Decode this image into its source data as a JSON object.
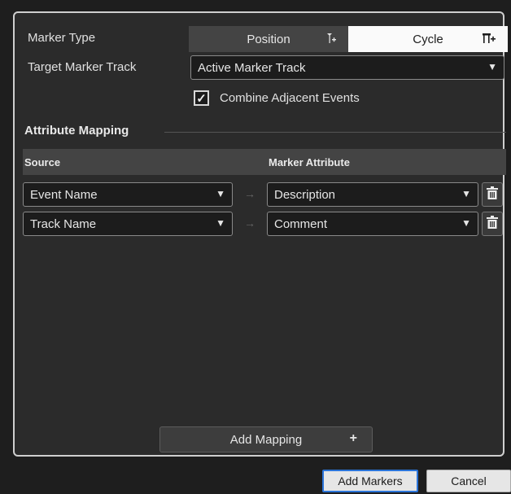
{
  "dialog": {
    "marker_type_label": "Marker Type",
    "marker_type_options": [
      "Position",
      "Cycle"
    ],
    "selected_marker_type": "Position",
    "target_track_label": "Target Marker Track",
    "target_track_value": "Active Marker Track",
    "combine_label": "Combine Adjacent Events",
    "combine_checked": true,
    "attribute_mapping_title": "Attribute Mapping",
    "columns": {
      "source": "Source",
      "marker_attribute": "Marker Attribute"
    },
    "mappings": [
      {
        "source": "Event Name",
        "attribute": "Description"
      },
      {
        "source": "Track Name",
        "attribute": "Comment"
      }
    ],
    "add_mapping_label": "Add Mapping",
    "add_mapping_icon": "+",
    "icons": {
      "dropdown": "▼",
      "arrow": "→",
      "check": "✓"
    }
  },
  "footer": {
    "add_markers_label": "Add Markers",
    "cancel_label": "Cancel"
  },
  "colors": {
    "accent": "#2b74d9",
    "panel": "#2b2b2b",
    "selected_segment": "#fafafa"
  }
}
